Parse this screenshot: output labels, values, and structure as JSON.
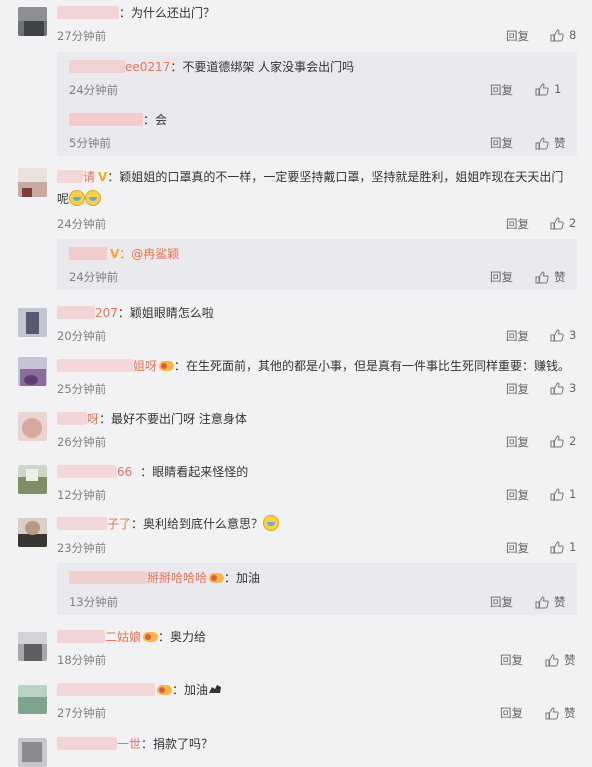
{
  "comments": [
    {
      "name_visible": "",
      "text": "：为什么还出门？",
      "time": "27分钟前",
      "reply": "回复",
      "likes": "8"
    },
    {
      "name_visible": "ee0217",
      "text": "：不要道德绑架 人家没事会出门吗",
      "time": "24分钟前",
      "reply": "回复",
      "likes": "1"
    },
    {
      "name_visible": "",
      "text": "：会",
      "time": "5分钟前",
      "reply": "回复",
      "likes": "赞"
    },
    {
      "name_visible": "请",
      "text": "：颖姐姐的口罩真的不一样，一定要坚持戴口罩，坚持就是胜利，姐姐咋现在天天出门",
      "text2": "呢",
      "time": "24分钟前",
      "reply": "回复",
      "likes": "2"
    },
    {
      "name_visible": "",
      "text": "：@冉鲨颖",
      "time": "24分钟前",
      "reply": "回复",
      "likes": "赞"
    },
    {
      "name_visible": "207",
      "text": "：颖姐眼睛怎么啦",
      "time": "20分钟前",
      "reply": "回复",
      "likes": "3"
    },
    {
      "name_visible": "姐呀",
      "text": "：在生死面前，其他的都是小事，但是真有一件事比生死同样重要：赚钱。",
      "time": "25分钟前",
      "reply": "回复",
      "likes": "3"
    },
    {
      "name_visible": "呀",
      "text": "：最好不要出门呀 注意身体",
      "time": "26分钟前",
      "reply": "回复",
      "likes": "2"
    },
    {
      "name_visible": "66",
      "text": "：眼睛看起来怪怪的",
      "time": "12分钟前",
      "reply": "回复",
      "likes": "1"
    },
    {
      "name_visible": "子了",
      "text": "：奥利给到底什么意思？",
      "time": "23分钟前",
      "reply": "回复",
      "likes": "1"
    },
    {
      "name_visible": "掰掰哈哈哈",
      "text": "：加油",
      "time": "13分钟前",
      "reply": "回复",
      "likes": "赞"
    },
    {
      "name_visible": "二姑娘",
      "text": "：奥力给",
      "time": "18分钟前",
      "reply": "回复",
      "likes": "赞"
    },
    {
      "name_visible": "",
      "text": "：加油",
      "time": "27分钟前",
      "reply": "回复",
      "likes": "赞"
    },
    {
      "name_visible": "一世",
      "text": "：捐款了吗？"
    }
  ]
}
